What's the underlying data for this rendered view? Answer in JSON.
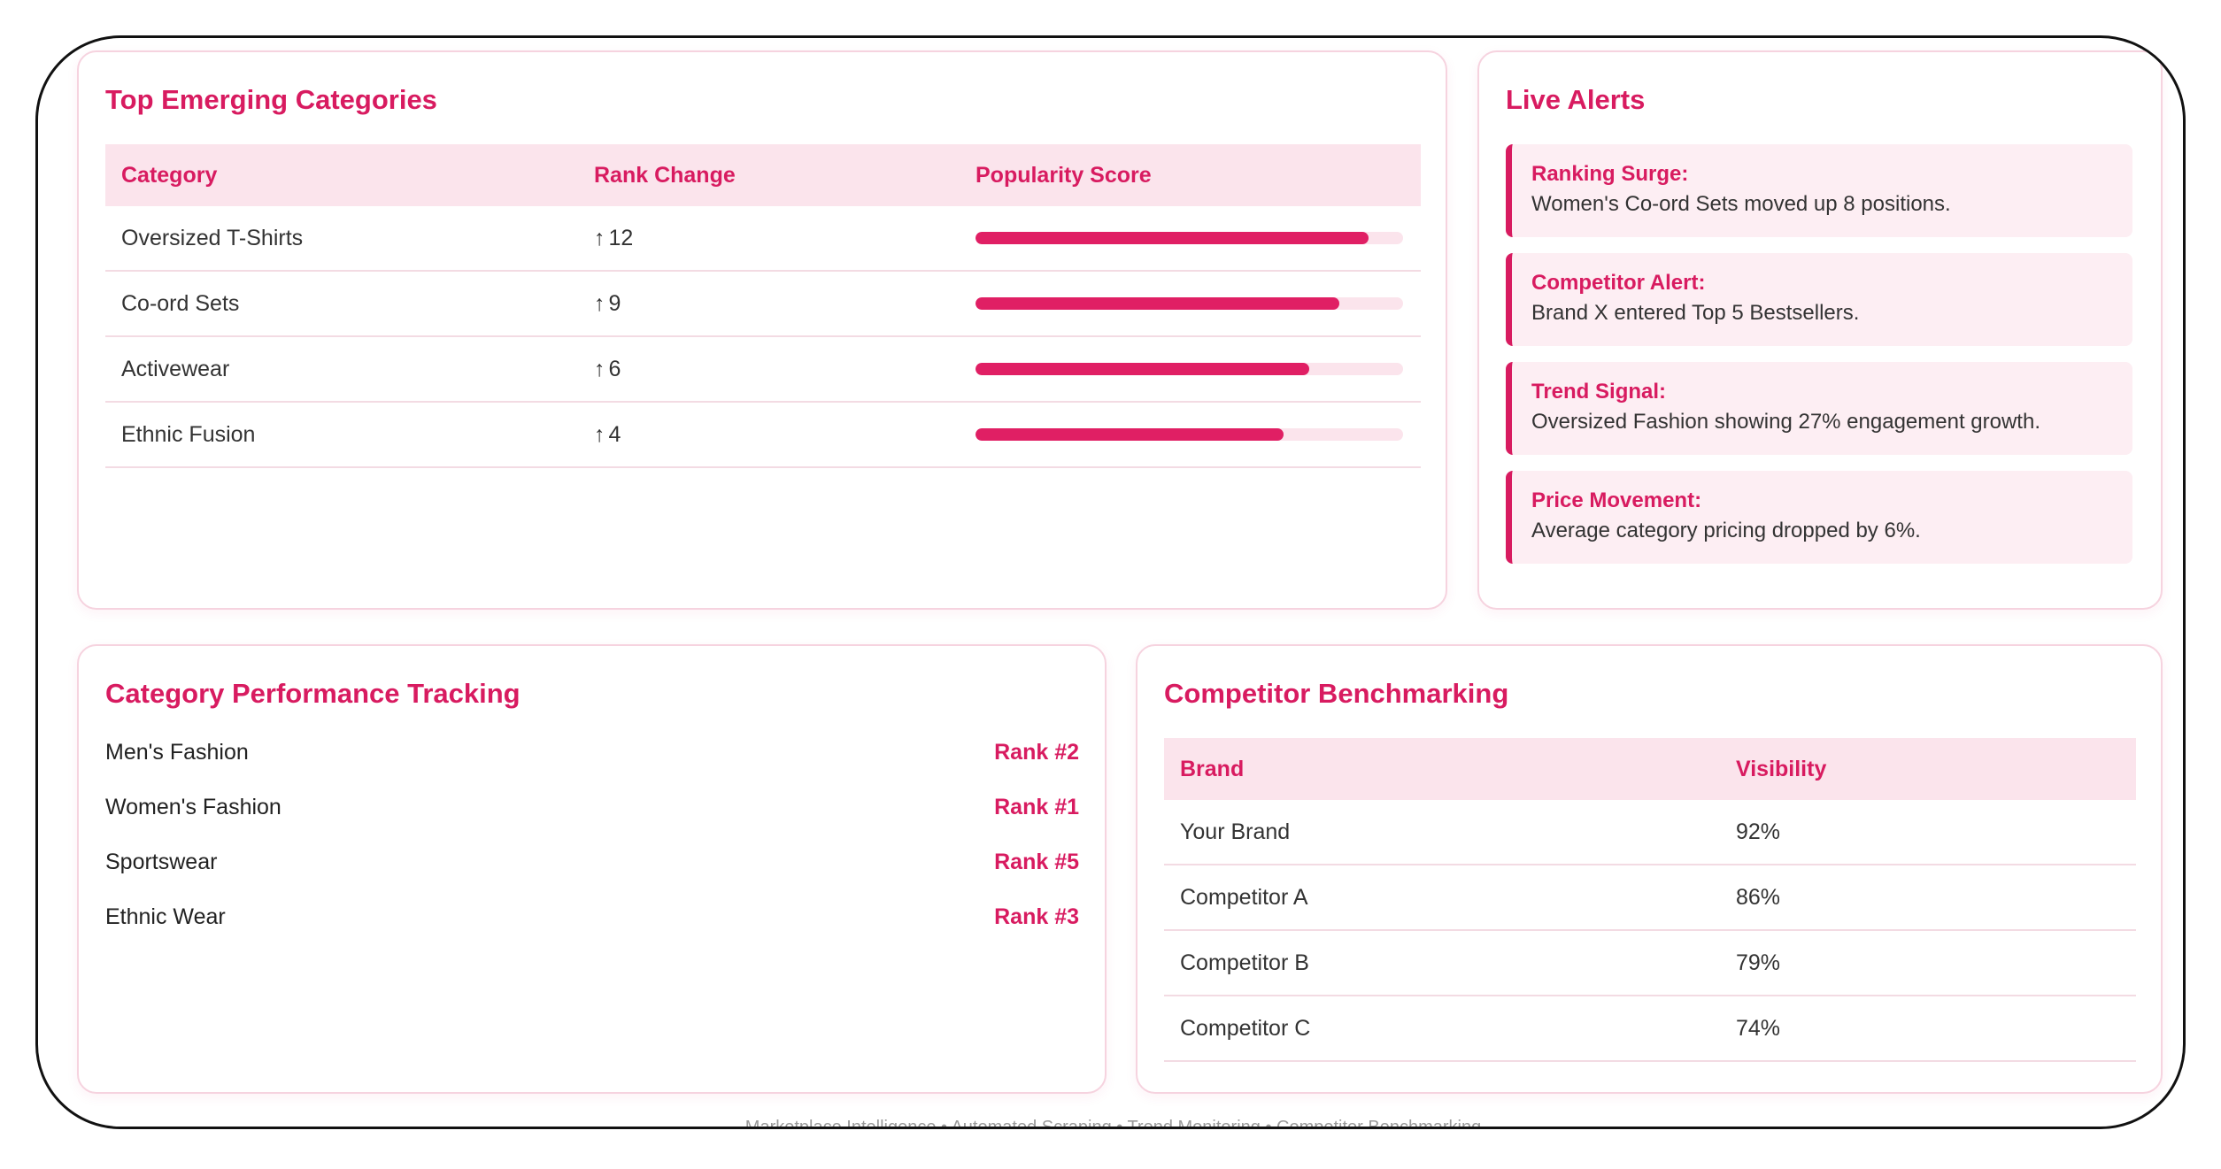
{
  "top_emerging": {
    "title": "Top Emerging Categories",
    "columns": [
      "Category",
      "Rank Change",
      "Popularity Score"
    ],
    "rows": [
      {
        "category": "Oversized T-Shirts",
        "rank_change": "12",
        "score": 0.92
      },
      {
        "category": "Co-ord Sets",
        "rank_change": "9",
        "score": 0.85
      },
      {
        "category": "Activewear",
        "rank_change": "6",
        "score": 0.78
      },
      {
        "category": "Ethnic Fusion",
        "rank_change": "4",
        "score": 0.72
      }
    ],
    "arrow_icon": "arrow-up-icon",
    "accent_color": "#e01f64"
  },
  "live_alerts": {
    "title": "Live Alerts",
    "items": [
      {
        "title": "Ranking Surge:",
        "text": "Women's Co-ord Sets moved up 8 positions."
      },
      {
        "title": "Competitor Alert:",
        "text": "Brand X entered Top 5 Bestsellers."
      },
      {
        "title": "Trend Signal:",
        "text": "Oversized Fashion showing 27% engagement growth."
      },
      {
        "title": "Price Movement:",
        "text": "Average category pricing dropped by 6%."
      }
    ]
  },
  "category_performance": {
    "title": "Category Performance Tracking",
    "items": [
      {
        "name": "Men's Fashion",
        "rank": "Rank #2"
      },
      {
        "name": "Women's Fashion",
        "rank": "Rank #1"
      },
      {
        "name": "Sportswear",
        "rank": "Rank #5"
      },
      {
        "name": "Ethnic Wear",
        "rank": "Rank #3"
      }
    ]
  },
  "competitor_benchmarking": {
    "title": "Competitor Benchmarking",
    "columns": [
      "Brand",
      "Visibility"
    ],
    "rows": [
      {
        "brand": "Your Brand",
        "visibility": "92%"
      },
      {
        "brand": "Competitor A",
        "visibility": "86%"
      },
      {
        "brand": "Competitor B",
        "visibility": "79%"
      },
      {
        "brand": "Competitor C",
        "visibility": "74%"
      }
    ]
  },
  "footer": {
    "text": "Marketplace Intelligence • Automated Scraping • Trend Monitoring • Competitor Benchmarking"
  },
  "colors": {
    "accent": "#d81b60",
    "header_bg": "#fbe4ec",
    "card_border": "#f6d3df",
    "frame_border": "#111111"
  }
}
